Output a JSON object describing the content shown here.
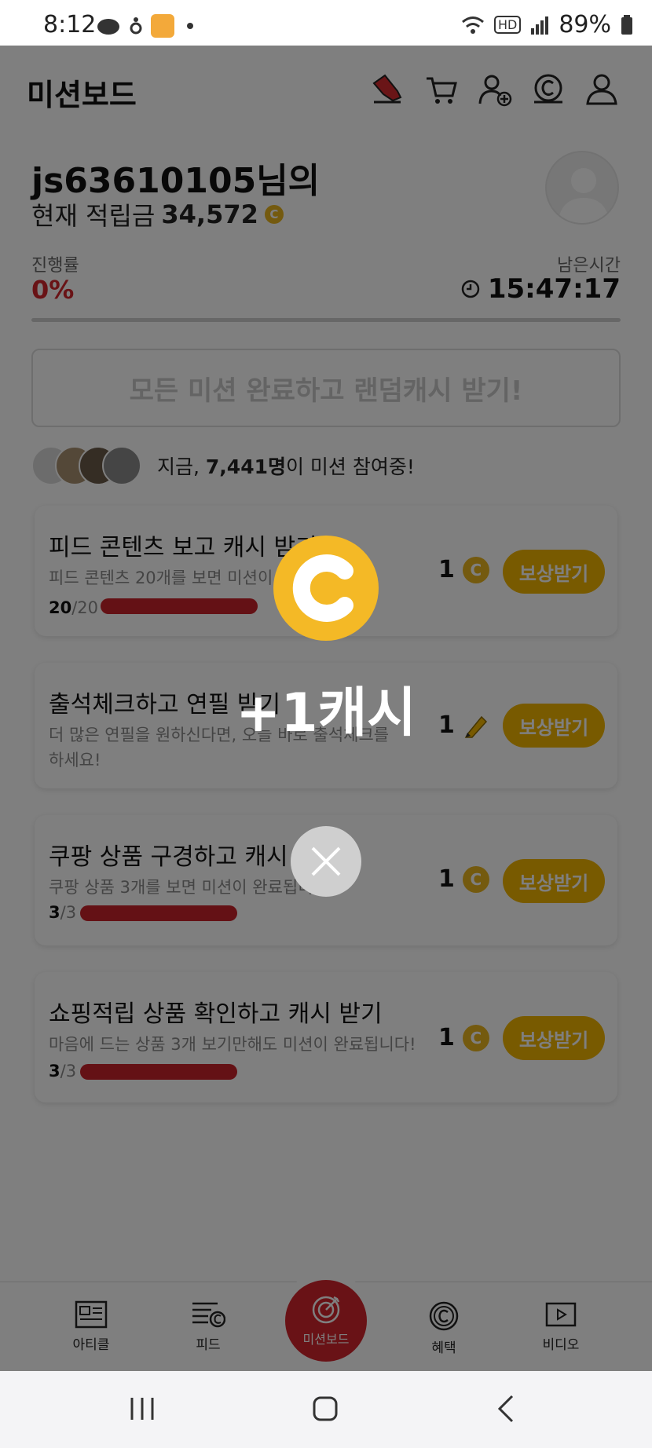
{
  "status_bar": {
    "time": "8:12",
    "battery": "89%",
    "hd_label": "HD"
  },
  "header": {
    "title": "미션보드",
    "icons": [
      "shoe-icon",
      "cart-icon",
      "add-user-icon",
      "cash-icon",
      "profile-icon"
    ]
  },
  "user": {
    "name": "js63610105님의",
    "balance_label": "현재 적립금",
    "balance_value": "34,572",
    "coin_symbol": "C"
  },
  "progress": {
    "label": "진행률",
    "value": "0%",
    "remaining_label": "남은시간",
    "remaining_value": "15:47:17"
  },
  "bonus_banner": "모든 미션 완료하고 랜덤캐시 받기!",
  "participants": {
    "prefix": "지금, ",
    "count": "7,441명",
    "suffix": "이 미션 참여중!"
  },
  "missions": [
    {
      "title": "피드 콘텐츠 보고 캐시 받기",
      "desc": "피드 콘텐츠 20개를 보면 미션이 완료됩니다!",
      "count_done": "20",
      "count_total": "/20",
      "progress": 1.0,
      "reward": "1",
      "reward_icon": "coin-icon",
      "button": "보상받기"
    },
    {
      "title": "출석체크하고 연필 받기",
      "desc_line1": "더 많은 연필을 원하신다면, 오늘 바로 출석체크를",
      "desc_line2": "하세요!",
      "reward": "1",
      "reward_icon": "pencil-icon",
      "button": "보상받기"
    },
    {
      "title": "쿠팡 상품 구경하고 캐시 받기",
      "desc": "쿠팡 상품 3개를 보면 미션이 완료됩니다!",
      "count_done": "3",
      "count_total": "/3",
      "progress": 1.0,
      "reward": "1",
      "reward_icon": "coin-icon",
      "button": "보상받기"
    },
    {
      "title": "쇼핑적립 상품 확인하고 캐시 받기",
      "desc": "마음에 드는 상품 3개 보기만해도 미션이 완료됩니다!",
      "count_done": "3",
      "count_total": "/3",
      "progress": 1.0,
      "reward": "1",
      "reward_icon": "coin-icon",
      "button": "보상받기"
    }
  ],
  "bottom_nav": {
    "items": [
      "아티클",
      "피드",
      "미션보드",
      "혜택",
      "비디오"
    ]
  },
  "overlay": {
    "reward_text": "+1캐시",
    "coin_symbol": "C"
  },
  "colors": {
    "accent_red": "#d2272c",
    "coin_yellow": "#f4b926",
    "button_yellow": "#f0b400"
  }
}
